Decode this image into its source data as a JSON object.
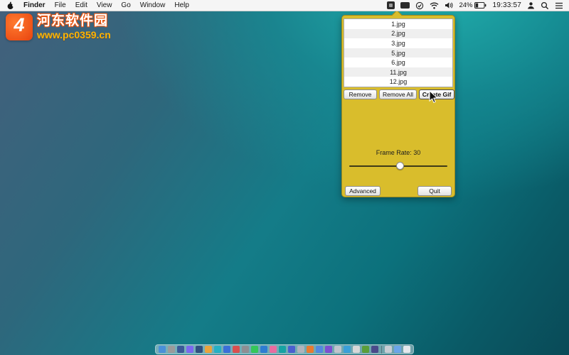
{
  "menu_bar": {
    "menus": [
      "Finder",
      "File",
      "Edit",
      "View",
      "Go",
      "Window",
      "Help"
    ],
    "status": {
      "battery": "24%",
      "clock": "19:33:57",
      "icons": [
        "gif-app-icon",
        "input-device-icon",
        "sync-check-icon",
        "wifi-icon",
        "volume-icon",
        "battery-icon",
        "user-icon",
        "search-icon",
        "notification-list-icon"
      ]
    }
  },
  "watermark": {
    "site_name": "河东软件园",
    "site_url": "www.pc0359.cn"
  },
  "panel": {
    "files": [
      "1.jpg",
      "2.jpg",
      "3.jpg",
      "5.jpg",
      "6.jpg",
      "11.jpg",
      "12.jpg"
    ],
    "buttons": {
      "remove": "Remove",
      "remove_all": "Remove All",
      "create_gif": "Create Gif",
      "advanced": "Advanced",
      "quit": "Quit"
    },
    "frame_rate_label": "Frame Rate: 30",
    "frame_rate": 30
  },
  "colors": {
    "panel_bg": "#d9bd2c",
    "panel_border": "#9d8a1d",
    "menubar_bg": "#f5f5f5",
    "wallpaper_teal": "#147c88",
    "watermark_orange": "#e8540f"
  }
}
